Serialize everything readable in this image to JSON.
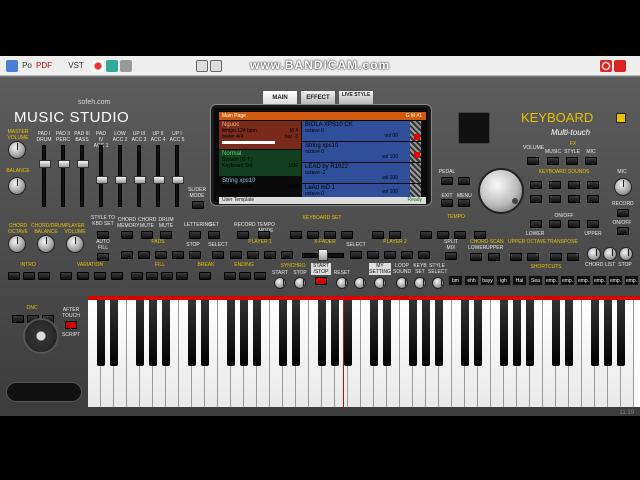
{
  "toolbar": {
    "items": [
      "Po",
      "PDF",
      "VST"
    ],
    "watermark": "www.BANDICAM.com"
  },
  "brand": {
    "name": "MUSIC STUDIO",
    "site": "sofeh.com",
    "keyboard": "KEYBOARD",
    "multitouch": "Multi-touch"
  },
  "tabs": [
    {
      "label": "MAIN",
      "active": true
    },
    {
      "label": "EFFECT",
      "active": false
    },
    {
      "label": "LIVE STYLE",
      "active": false
    }
  ],
  "lcd": {
    "header": "Main Page",
    "header_right": "G M  #1",
    "left": [
      {
        "line1": "Nguoc",
        "line2": "tempo 124 bpm",
        "line2r": "M 4",
        "line3": "meter 4/4",
        "line3r": "bar -3"
      },
      {
        "line1": "Normal",
        "line2": "System (G.T.)",
        "line3": "Keyboard Set",
        "line3r": "1/06"
      },
      {
        "line1": "String xps10",
        "line2": "Keyboard Set",
        "line2r": "1/06"
      }
    ],
    "right": [
      {
        "name": "BIOLA XPS10 CK",
        "octave": "octave 0",
        "vol": "vol 00"
      },
      {
        "name": "String xps10",
        "octave": "octave 0",
        "vol": "vol 100"
      },
      {
        "name": "LEAD by R1922",
        "octave": "octave -2",
        "vol": "vol 100"
      },
      {
        "name": "LeAd mD 1",
        "octave": "octave 0",
        "vol": "vol 100"
      }
    ],
    "footer": "User Template",
    "footer_right": "Ready"
  },
  "left_panel": {
    "master_volume": "MASTER VOLUME",
    "balance": "BALANCE",
    "chord_octave": "CHORD OCTAVE",
    "chord_drum_balance": "CHORD/DRUM BALANCE",
    "player_volume": "PLAYER VOLUME",
    "sliders": [
      "PAD I DRUM",
      "PAD II PERC",
      "PAD III BASS",
      "PAD IV ACC 1",
      "LOW ACC 2",
      "UP III ACC 3",
      "UP II ACC 4",
      "UP I ACC 5"
    ],
    "slider_mode": "SLIDER MODE",
    "style_to_kbd": "STYLE TO KBD SET",
    "chord_memory": "CHORD MEMORY",
    "chord_mute": "CHORD MUTE",
    "drum_mute": "DRUM MUTE",
    "letter": "LETTERING",
    "set": "SET",
    "record": "RECORD",
    "tempo_mode": "TEMPO MODE",
    "auto_fill": "AUTO FILL",
    "pads": "PADS",
    "stop": "STOP",
    "intro": "INTRO",
    "variation": "VARIATION",
    "fill": "FILL",
    "break": "BREAK",
    "ending": "ENDING",
    "onc": "ONC",
    "after_touch": "AFTER TOUCH",
    "script": "SCRIPT"
  },
  "mid_panel": {
    "keyboard_set": "KEYBOARD SET",
    "tempo": "TEMPO",
    "player1": "PLAYER 1",
    "player2": "PLAYER 2",
    "xfader": "X-FADER",
    "select": "SELECT",
    "start": "START",
    "stop": "STOP",
    "synchro": "SYNCHRO",
    "start_stop": "START /STOP",
    "reset": "RESET",
    "my_setting": "MY SETTING",
    "loop_sound": "LOOP SOUND",
    "keyb_set": "KEYB SET",
    "style_select": "STYLE SELECT",
    "split": "SPLIT",
    "mix": "MIX"
  },
  "right_panel": {
    "volume": "VOLUME",
    "fx": "FX",
    "music": "MUSIC",
    "style": "STYLE",
    "mic": "MIC",
    "keyboard_sounds": "KEYBOARD SOUNDS",
    "pedal": "PEDAL",
    "menu": "MENU",
    "exit": "EXIT",
    "record": "RECORD",
    "onoff": "ON/OFF",
    "lower": "LOWER",
    "upper": "UPPER",
    "chord_scan": "CHORD SCAN",
    "upper_octave": "UPPER OCTAVE",
    "transpose": "TRANSPOSE",
    "shortcuts": "SHORTCUTS",
    "chord": "CHORD",
    "list": "LIST",
    "stop": "STOP",
    "shortcut_labels": [
      "bm",
      "ehh",
      "bayy",
      "igh",
      "Hal",
      "Sea",
      "emp.",
      "emp.",
      "emp.",
      "emp.",
      "emp.",
      "emp."
    ]
  },
  "status_right": "11:19",
  "colors": {
    "accent": "#e6c100",
    "lcd_header": "#d25a10",
    "lcd_panel": "#2f4f9a",
    "red": "#dd0000"
  }
}
